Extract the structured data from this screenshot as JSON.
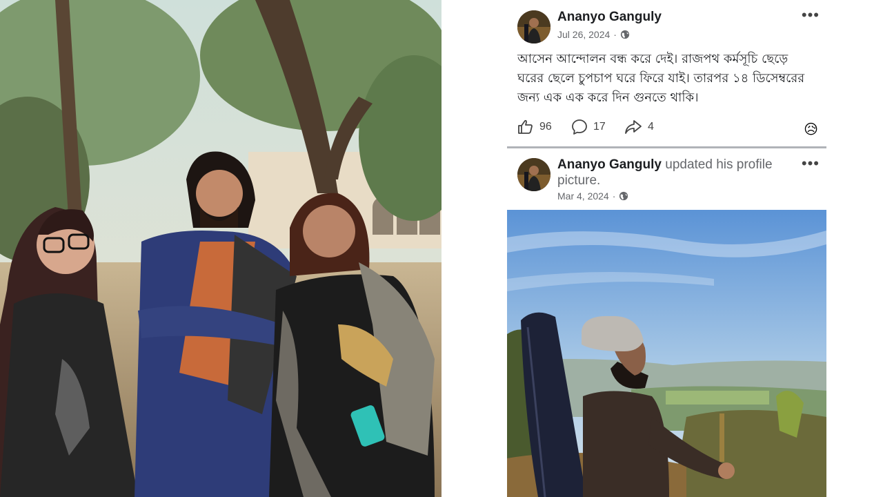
{
  "left_photo": {
    "alt": "Three people posing outdoors under trees"
  },
  "post1": {
    "author": "Ananyo Ganguly",
    "date": "Jul 26, 2024",
    "privacy_icon": "globe-icon",
    "more_label": "•••",
    "text": "আসেন আন্দোলন বন্ধ করে দেই। রাজপথ কর্মসূচি ছেড়ে ঘরের ছেলে চুপচাপ ঘরে ফিরে যাই। তারপর ১৪ ডিসেম্বরের জন্য এক এক করে দিন গুনতে থাকি।",
    "likes": "96",
    "comments": "17",
    "shares": "4",
    "reaction_emoji": "😥"
  },
  "post2": {
    "author": "Ananyo Ganguly",
    "action_text": "updated his profile picture.",
    "date": "Mar 4, 2024",
    "privacy_icon": "globe-icon",
    "more_label": "•••"
  },
  "colors": {
    "text_primary": "#1c1e21",
    "text_secondary": "#65676b",
    "divider": "#b0b3b8"
  }
}
